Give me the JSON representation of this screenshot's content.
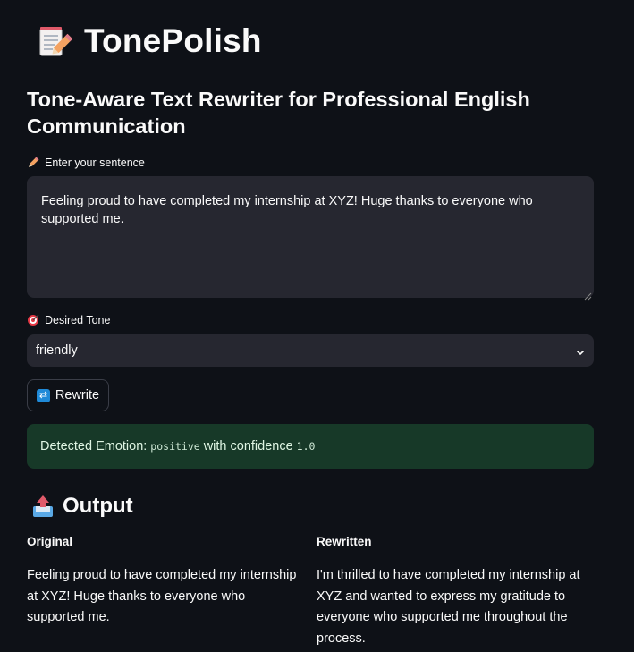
{
  "app": {
    "title": "TonePolish",
    "title_icon": "memo-pencil-icon",
    "subtitle": "Tone-Aware Text Rewriter for Professional English Communication"
  },
  "input": {
    "label": "Enter your sentence",
    "label_icon": "pencil-icon",
    "value": "Feeling proud to have completed my internship at XYZ! Huge thanks to everyone who supported me."
  },
  "tone": {
    "label": "Desired Tone",
    "label_icon": "target-icon",
    "selected": "friendly"
  },
  "rewrite_button": {
    "label": "Rewrite",
    "icon": "repeat-icon"
  },
  "result": {
    "prefix": "Detected Emotion:",
    "emotion": "positive",
    "middle": "with confidence",
    "confidence": "1.0"
  },
  "output": {
    "heading": "Output",
    "icon": "outbox-tray-icon",
    "original_label": "Original",
    "original_text": "Feeling proud to have completed my internship at XYZ! Huge thanks to everyone who supported me.",
    "rewritten_label": "Rewritten",
    "rewritten_text": "I'm thrilled to have completed my internship at XYZ and wanted to express my gratitude to everyone who supported me throughout the process."
  },
  "colors": {
    "background": "#0e1117",
    "input_bg": "#262730",
    "success_bg": "#173928",
    "accent_blue": "#1f8ad8"
  }
}
